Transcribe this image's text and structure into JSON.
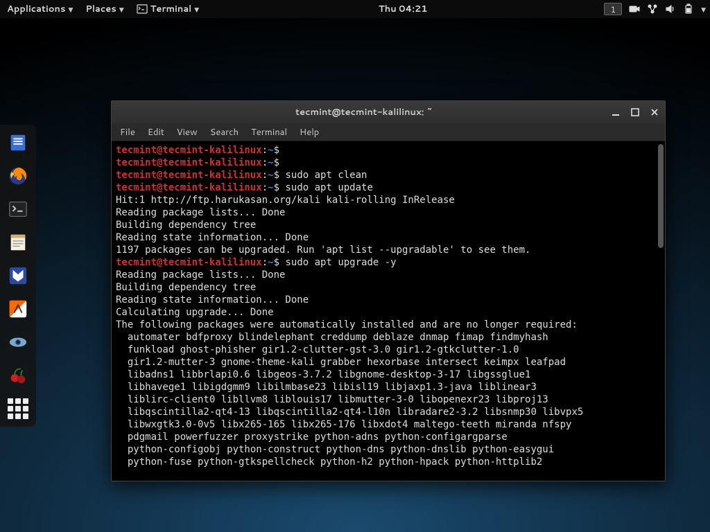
{
  "panel": {
    "applications": "Applications",
    "places": "Places",
    "terminal": "Terminal",
    "clock": "Thu 04:21",
    "workspace": "1"
  },
  "dock": {
    "items": [
      "files-icon",
      "firefox-icon",
      "terminal-icon",
      "text-editor-icon",
      "metasploit-icon",
      "burpsuite-icon",
      "eye-icon",
      "cherrytree-icon",
      "apps-grid-icon"
    ]
  },
  "window": {
    "title": "tecmint@tecmint-kalilinux: ~",
    "menubar": [
      "File",
      "Edit",
      "View",
      "Search",
      "Terminal",
      "Help"
    ]
  },
  "prompt": {
    "user": "tecmint@tecmint-kalilinux",
    "path": "~",
    "symbol": "$"
  },
  "session": [
    {
      "type": "prompt",
      "cmd": ""
    },
    {
      "type": "prompt",
      "cmd": ""
    },
    {
      "type": "prompt",
      "cmd": "sudo apt clean"
    },
    {
      "type": "prompt",
      "cmd": "sudo apt update"
    },
    {
      "type": "out",
      "text": "Hit:1 http://ftp.harukasan.org/kali kali-rolling InRelease"
    },
    {
      "type": "out",
      "text": "Reading package lists... Done"
    },
    {
      "type": "out",
      "text": "Building dependency tree"
    },
    {
      "type": "out",
      "text": "Reading state information... Done"
    },
    {
      "type": "out",
      "text": "1197 packages can be upgraded. Run 'apt list --upgradable' to see them."
    },
    {
      "type": "prompt",
      "cmd": "sudo apt upgrade -y"
    },
    {
      "type": "out",
      "text": "Reading package lists... Done"
    },
    {
      "type": "out",
      "text": "Building dependency tree"
    },
    {
      "type": "out",
      "text": "Reading state information... Done"
    },
    {
      "type": "out",
      "text": "Calculating upgrade... Done"
    },
    {
      "type": "out",
      "text": "The following packages were automatically installed and are no longer required:"
    },
    {
      "type": "out",
      "text": "  automater bdfproxy blindelephant creddump deblaze dnmap fimap findmyhash"
    },
    {
      "type": "out",
      "text": "  funkload ghost-phisher gir1.2-clutter-gst-3.0 gir1.2-gtkclutter-1.0"
    },
    {
      "type": "out",
      "text": "  gir1.2-mutter-3 gnome-theme-kali grabber hexorbase intersect keimpx leafpad"
    },
    {
      "type": "out",
      "text": "  libadns1 libbrlapi0.6 libgeos-3.7.2 libgnome-desktop-3-17 libgssglue1"
    },
    {
      "type": "out",
      "text": "  libhavege1 libigdgmm9 libilmbase23 libisl19 libjaxp1.3-java liblinear3"
    },
    {
      "type": "out",
      "text": "  liblirc-client0 libllvm8 liblouis17 libmutter-3-0 libopenexr23 libproj13"
    },
    {
      "type": "out",
      "text": "  libqscintilla2-qt4-13 libqscintilla2-qt4-l10n libradare2-3.2 libsnmp30 libvpx5"
    },
    {
      "type": "out",
      "text": "  libwxgtk3.0-0v5 libx265-165 libx265-176 libxdot4 maltego-teeth miranda nfspy"
    },
    {
      "type": "out",
      "text": "  pdgmail powerfuzzer proxystrike python-adns python-configargparse"
    },
    {
      "type": "out",
      "text": "  python-configobj python-construct python-dns python-dnslib python-easygui"
    },
    {
      "type": "out",
      "text": "  python-fuse python-gtkspellcheck python-h2 python-hpack python-httplib2"
    }
  ]
}
